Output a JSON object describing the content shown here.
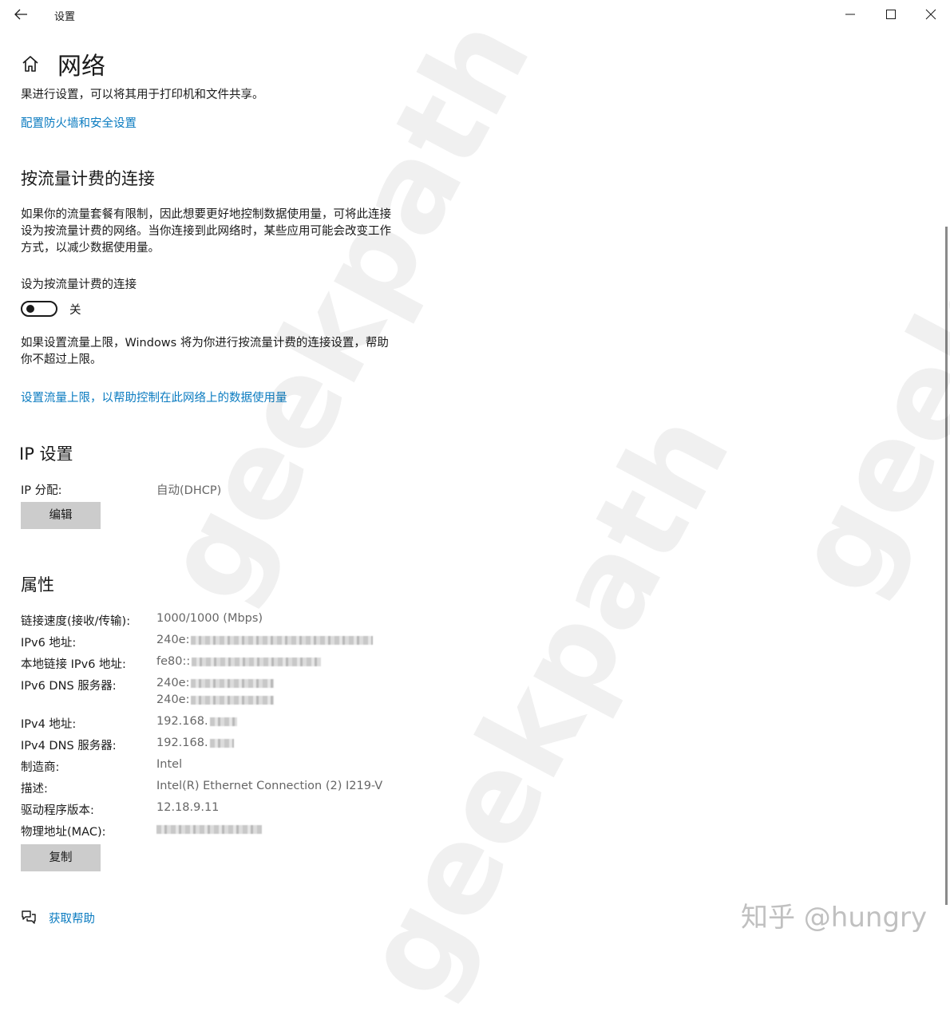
{
  "titlebar": {
    "title": "设置",
    "back_icon": "arrow-left-icon",
    "minimize_icon": "minimize-icon",
    "maximize_icon": "maximize-icon",
    "close_icon": "close-icon"
  },
  "page": {
    "home_icon": "home-icon",
    "title": "网络"
  },
  "firewall": {
    "text": "果进行设置，可以将其用于打印机和文件共享。",
    "link": "配置防火墙和安全设置"
  },
  "metered": {
    "heading": "按流量计费的连接",
    "description_lines": [
      "如果你的流量套餐有限制，因此想要更好地控制数据使用量，可将此连接",
      "设为按流量计费的网络。当你连接到此网络时，某些应用可能会改变工作",
      "方式，以减少数据使用量。"
    ],
    "toggle_label": "设为按流量计费的连接",
    "toggle_state": "关",
    "note_lines": [
      "如果设置流量上限，Windows 将为你进行按流量计费的连接设置，帮助",
      "你不超过上限。"
    ],
    "link": "设置流量上限，以帮助控制在此网络上的数据使用量"
  },
  "ip": {
    "heading": "IP 设置",
    "assign_label": "IP 分配:",
    "assign_value": "自动(DHCP)",
    "edit_button": "编辑"
  },
  "properties": {
    "heading": "属性",
    "rows": [
      {
        "label": "链接速度(接收/传输):",
        "value": "1000/1000 (Mbps)"
      },
      {
        "label": "IPv6 地址:",
        "value": "240e:"
      },
      {
        "label": "本地链接 IPv6 地址:",
        "value": "fe80::"
      },
      {
        "label": "IPv6 DNS 服务器:",
        "value": "240e:",
        "value2": "240e:"
      },
      {
        "label": "IPv4 地址:",
        "value": "192.168."
      },
      {
        "label": "IPv4 DNS 服务器:",
        "value": "192.168."
      },
      {
        "label": "制造商:",
        "value": "Intel"
      },
      {
        "label": "描述:",
        "value": "Intel(R) Ethernet Connection (2) I219-V"
      },
      {
        "label": "驱动程序版本:",
        "value": "12.18.9.11"
      },
      {
        "label": "物理地址(MAC):",
        "value": ""
      }
    ],
    "copy_button": "复制"
  },
  "help": {
    "icon": "chat-help-icon",
    "link": "获取帮助"
  },
  "watermark": {
    "text": "geekpath",
    "credit": "知乎 @hungry"
  }
}
